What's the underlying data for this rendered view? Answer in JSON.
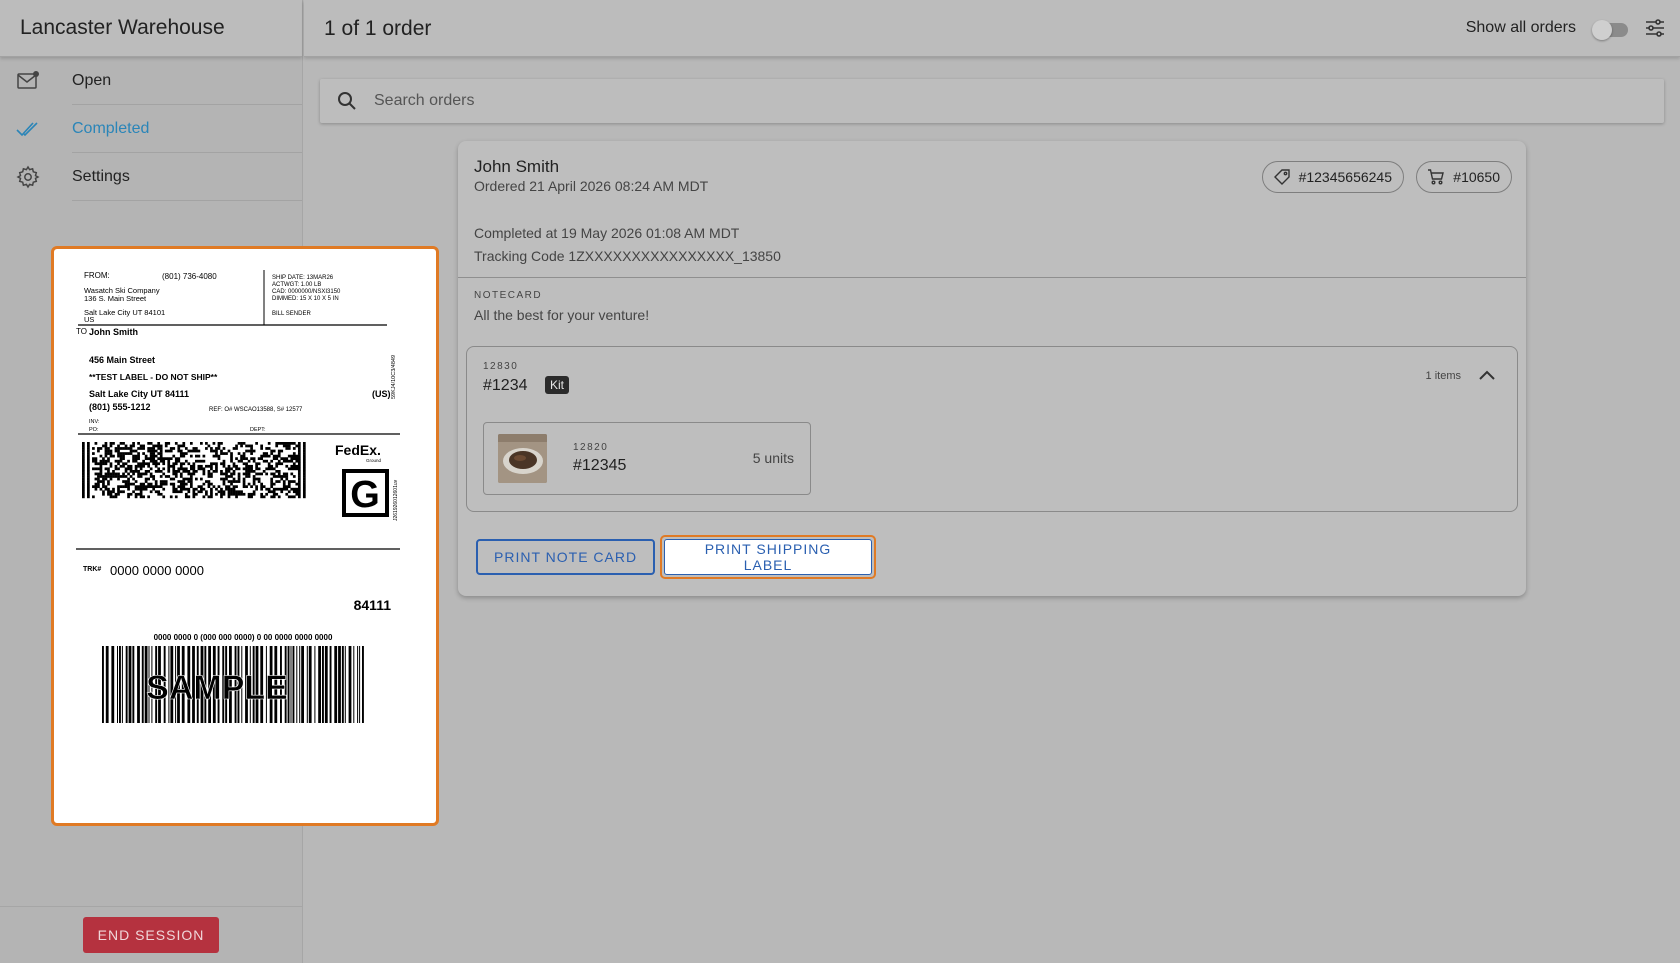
{
  "sidebar": {
    "title": "Lancaster Warehouse",
    "items": [
      {
        "label": "Open",
        "icon": "mail-icon"
      },
      {
        "label": "Completed",
        "icon": "double-check-icon"
      },
      {
        "label": "Settings",
        "icon": "gear-icon"
      }
    ],
    "end_session_label": "END SESSION"
  },
  "header": {
    "title": "1 of 1 order",
    "show_all_label": "Show all orders",
    "show_all_enabled": false
  },
  "search": {
    "placeholder": "Search orders"
  },
  "order": {
    "customer": "John Smith",
    "ordered": "Ordered 21 April 2026 08:24 AM MDT",
    "tag_id": "#12345656245",
    "cart_id": "#10650",
    "completed": "Completed at 19 May 2026 01:08 AM MDT",
    "tracking": "Tracking Code 1ZXXXXXXXXXXXXXXXX_13850",
    "notecard_label": "NOTECARD",
    "notecard_text": "All the best for your venture!",
    "kit": {
      "code": "12830",
      "number": "#1234",
      "badge": "Kit",
      "items": "1 items",
      "unit": {
        "code": "12820",
        "number": "#12345",
        "qty": "5 units"
      }
    },
    "print_note_label": "PRINT NOTE CARD",
    "print_shipping_label": "PRINT SHIPPING LABEL"
  },
  "shipping_label": {
    "from_label": "FROM:",
    "from_phone": "(801) 736-4080",
    "from_company": "Wasatch Ski Company",
    "from_street": "136 S. Main Street",
    "from_city": "Salt Lake City UT 84101",
    "from_country": "US",
    "ship_date": "SHIP DATE: 13MAR26",
    "actwgt": "ACTWGT: 1.00 LB",
    "cad": "CAD: 0000000/NSXI3150",
    "dimmed": "DIMMED: 15 X 10 X 5 IN",
    "bill": "BILL SENDER",
    "to_label": "TO",
    "to_name": "John Smith",
    "to_street": "456 Main Street",
    "to_note": "**TEST LABEL - DO NOT SHIP**",
    "to_city": "Salt Lake City UT 84111",
    "to_country": "(US)",
    "to_phone": "(801) 555-1212",
    "ref": "REF: O# WSCAO13588, S# 12577",
    "inv": "INV:",
    "po": "PO:",
    "dept": "DEPT:",
    "side_code": "59KJ4/10C3/4849",
    "side_code2": "J261926012601uv",
    "carrier_brand": "FedEx.",
    "carrier_service": "Ground",
    "service_letter": "G",
    "trk_label": "TRK#",
    "trk_number": "0000 0000 0000",
    "zip": "84111",
    "barcode_text": "0000 0000 0 (000 000 0000) 0 00 0000 0000 0000",
    "watermark": "SAMPLE"
  }
}
